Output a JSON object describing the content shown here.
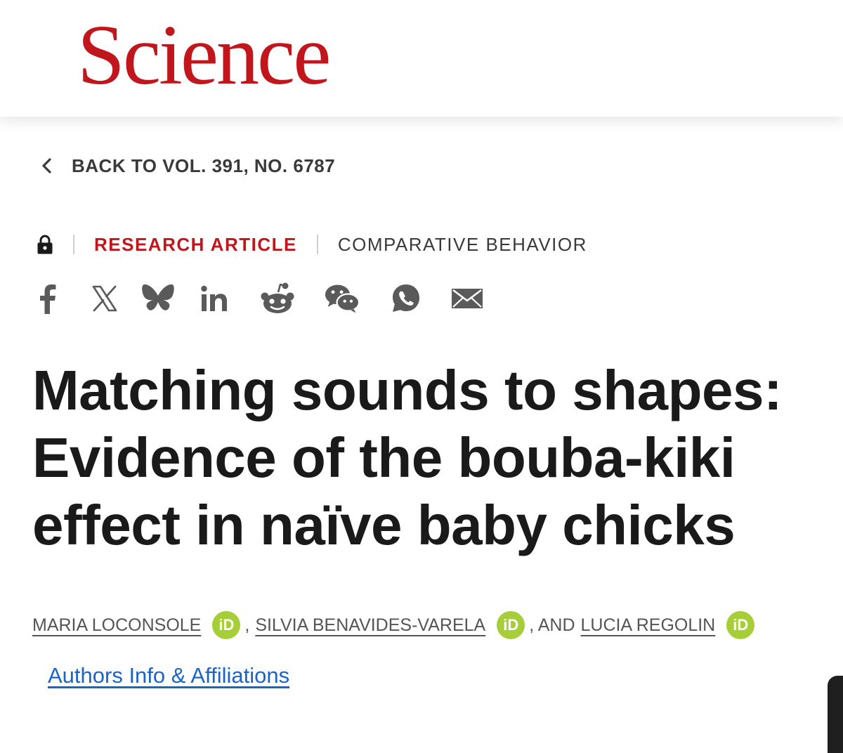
{
  "header": {
    "logo_text": "Science",
    "logo_color": "#c0161c"
  },
  "nav": {
    "back_label": "BACK TO VOL. 391, NO. 6787",
    "back_icon": "chevron-left-icon"
  },
  "article_meta": {
    "access_icon": "lock-icon",
    "article_type": "RESEARCH ARTICLE",
    "category": "COMPARATIVE BEHAVIOR"
  },
  "share": {
    "icons": [
      "facebook-icon",
      "x-icon",
      "bluesky-icon",
      "linkedin-icon",
      "reddit-icon",
      "wechat-icon",
      "whatsapp-icon",
      "email-icon"
    ]
  },
  "article": {
    "title": "Matching sounds to shapes: Evidence of the bouba-kiki effect in naïve baby chicks"
  },
  "authors": {
    "list": [
      {
        "name": "MARIA LOCONSOLE",
        "orcid_label": "iD"
      },
      {
        "name": "SILVIA BENAVIDES-VARELA",
        "orcid_label": "iD"
      },
      {
        "name": "LUCIA REGOLIN",
        "orcid_label": "iD"
      }
    ],
    "separator_1": ",",
    "separator_2": ", AND",
    "affiliations_link": "Authors Info & Affiliations"
  },
  "colors": {
    "accent_red": "#c0161c",
    "orcid_green": "#a6ce39",
    "link_blue": "#1a64c8",
    "icon_gray": "#5a5a5a",
    "text_dark": "#1a1a1a"
  }
}
